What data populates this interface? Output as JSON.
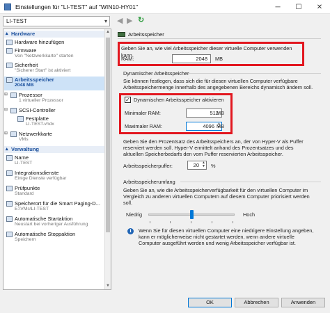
{
  "window": {
    "title": "Einstellungen für \"LI-TEST\" auf \"WIN10-HY01\"",
    "minimize": "─",
    "maximize": "☐",
    "close": "✕"
  },
  "toolbar": {
    "vm_selected": "LI-TEST",
    "back": "◀",
    "forward": "▶",
    "refresh": "↻"
  },
  "sidebar": {
    "hardware_header": "Hardware",
    "management_header": "Verwaltung",
    "items": [
      {
        "label": "Hardware hinzufügen",
        "sub": "",
        "icon": "add-hardware-icon"
      },
      {
        "label": "Firmware",
        "sub": "Von \"Netzwerkkarte\" starten",
        "icon": "firmware-icon"
      },
      {
        "label": "Sicherheit",
        "sub": "\"Sicherer Start\" ist aktiviert",
        "icon": "security-icon"
      },
      {
        "label": "Arbeitsspeicher",
        "sub": "2048 MB",
        "icon": "memory-icon"
      },
      {
        "label": "Prozessor",
        "sub": "1 virtueller Prozessor",
        "icon": "processor-icon"
      },
      {
        "label": "SCSI-Controller",
        "sub": "",
        "icon": "scsi-icon"
      },
      {
        "label": "Festplatte",
        "sub": "LI-TEST.vhdx",
        "icon": "hard-disk-icon"
      },
      {
        "label": "Netzwerkkarte",
        "sub": "VMs",
        "icon": "network-icon"
      },
      {
        "label": "Name",
        "sub": "LI-TEST",
        "icon": "name-icon"
      },
      {
        "label": "Integrationsdienste",
        "sub": "Einige Dienste verfügbar",
        "icon": "integration-icon"
      },
      {
        "label": "Prüfpunkte",
        "sub": "Standard",
        "icon": "checkpoint-icon"
      },
      {
        "label": "Speicherort für die Smart Paging-D...",
        "sub": "E:\\VMs\\LI-TEST",
        "icon": "paging-icon"
      },
      {
        "label": "Automatische Startaktion",
        "sub": "Neustart bei vorheriger Ausführung",
        "icon": "autostart-icon"
      },
      {
        "label": "Automatische Stoppaktion",
        "sub": "Speichern",
        "icon": "autostop-icon"
      }
    ]
  },
  "main": {
    "header": "Arbeitsspeicher",
    "intro": "Geben Sie an, wie viel Arbeitsspeicher dieser virtuelle Computer verwenden kann.",
    "ram_label": "RAM:",
    "ram_value": "2048",
    "ram_unit": "MB",
    "dynamic_group": "Dynamischer Arbeitsspeicher",
    "dynamic_desc_1": "Sie können festlegen, dass sich die für diesen virtuellen Computer verfügbare",
    "dynamic_desc_2": "Arbeitsspeichermenge innerhalb des angegebenen Bereichs dynamisch ändern soll.",
    "dynamic_checkbox_label": "Dynamischen Arbeitsspeicher aktivieren",
    "dynamic_checked": "✓",
    "min_label": "Minimaler RAM:",
    "min_value": "512",
    "min_unit": "MB",
    "max_label": "Maximaler RAM:",
    "max_value": "4096",
    "max_unit": "MB",
    "buffer_desc_1": "Geben Sie den Prozentsatz des Arbeitsspeichers an, der von Hyper-V als Puffer",
    "buffer_desc_2": "reserviert werden soll. Hyper-V ermittelt anhand des Prozentsatzes und des",
    "buffer_desc_3": "aktuellen Speicherbedarfs den vom Puffer reservierten Arbeitsspeicher.",
    "buffer_label": "Arbeitsspeicherpuffer:",
    "buffer_value": "20",
    "buffer_unit": "%",
    "weight_group": "Arbeitsspeicherumfang",
    "weight_desc_1": "Geben Sie an, wie die Arbeitsspeicherverfügbarkeit für den virtuellen Computer im",
    "weight_desc_2": "Vergleich zu anderen virtuellen Computern auf diesem Computer priorisiert werden",
    "weight_desc_3": "soll.",
    "low_label": "Niedrig",
    "high_label": "Hoch",
    "slider_value": 0.5,
    "info_1": "Wenn Sie für diesen virtuellen Computer eine niedrigere Einstellung angeben,",
    "info_2": "kann er möglicherweise nicht gestartet werden, wenn andere virtuelle",
    "info_3": "Computer ausgeführt werden und wenig Arbeitsspeicher verfügbar ist."
  },
  "buttons": {
    "ok": "OK",
    "cancel": "Abbrechen",
    "apply": "Anwenden"
  },
  "colors": {
    "highlight_red": "#e2171f",
    "accent_blue": "#0078d7",
    "header_blue": "#1a4f9c"
  }
}
